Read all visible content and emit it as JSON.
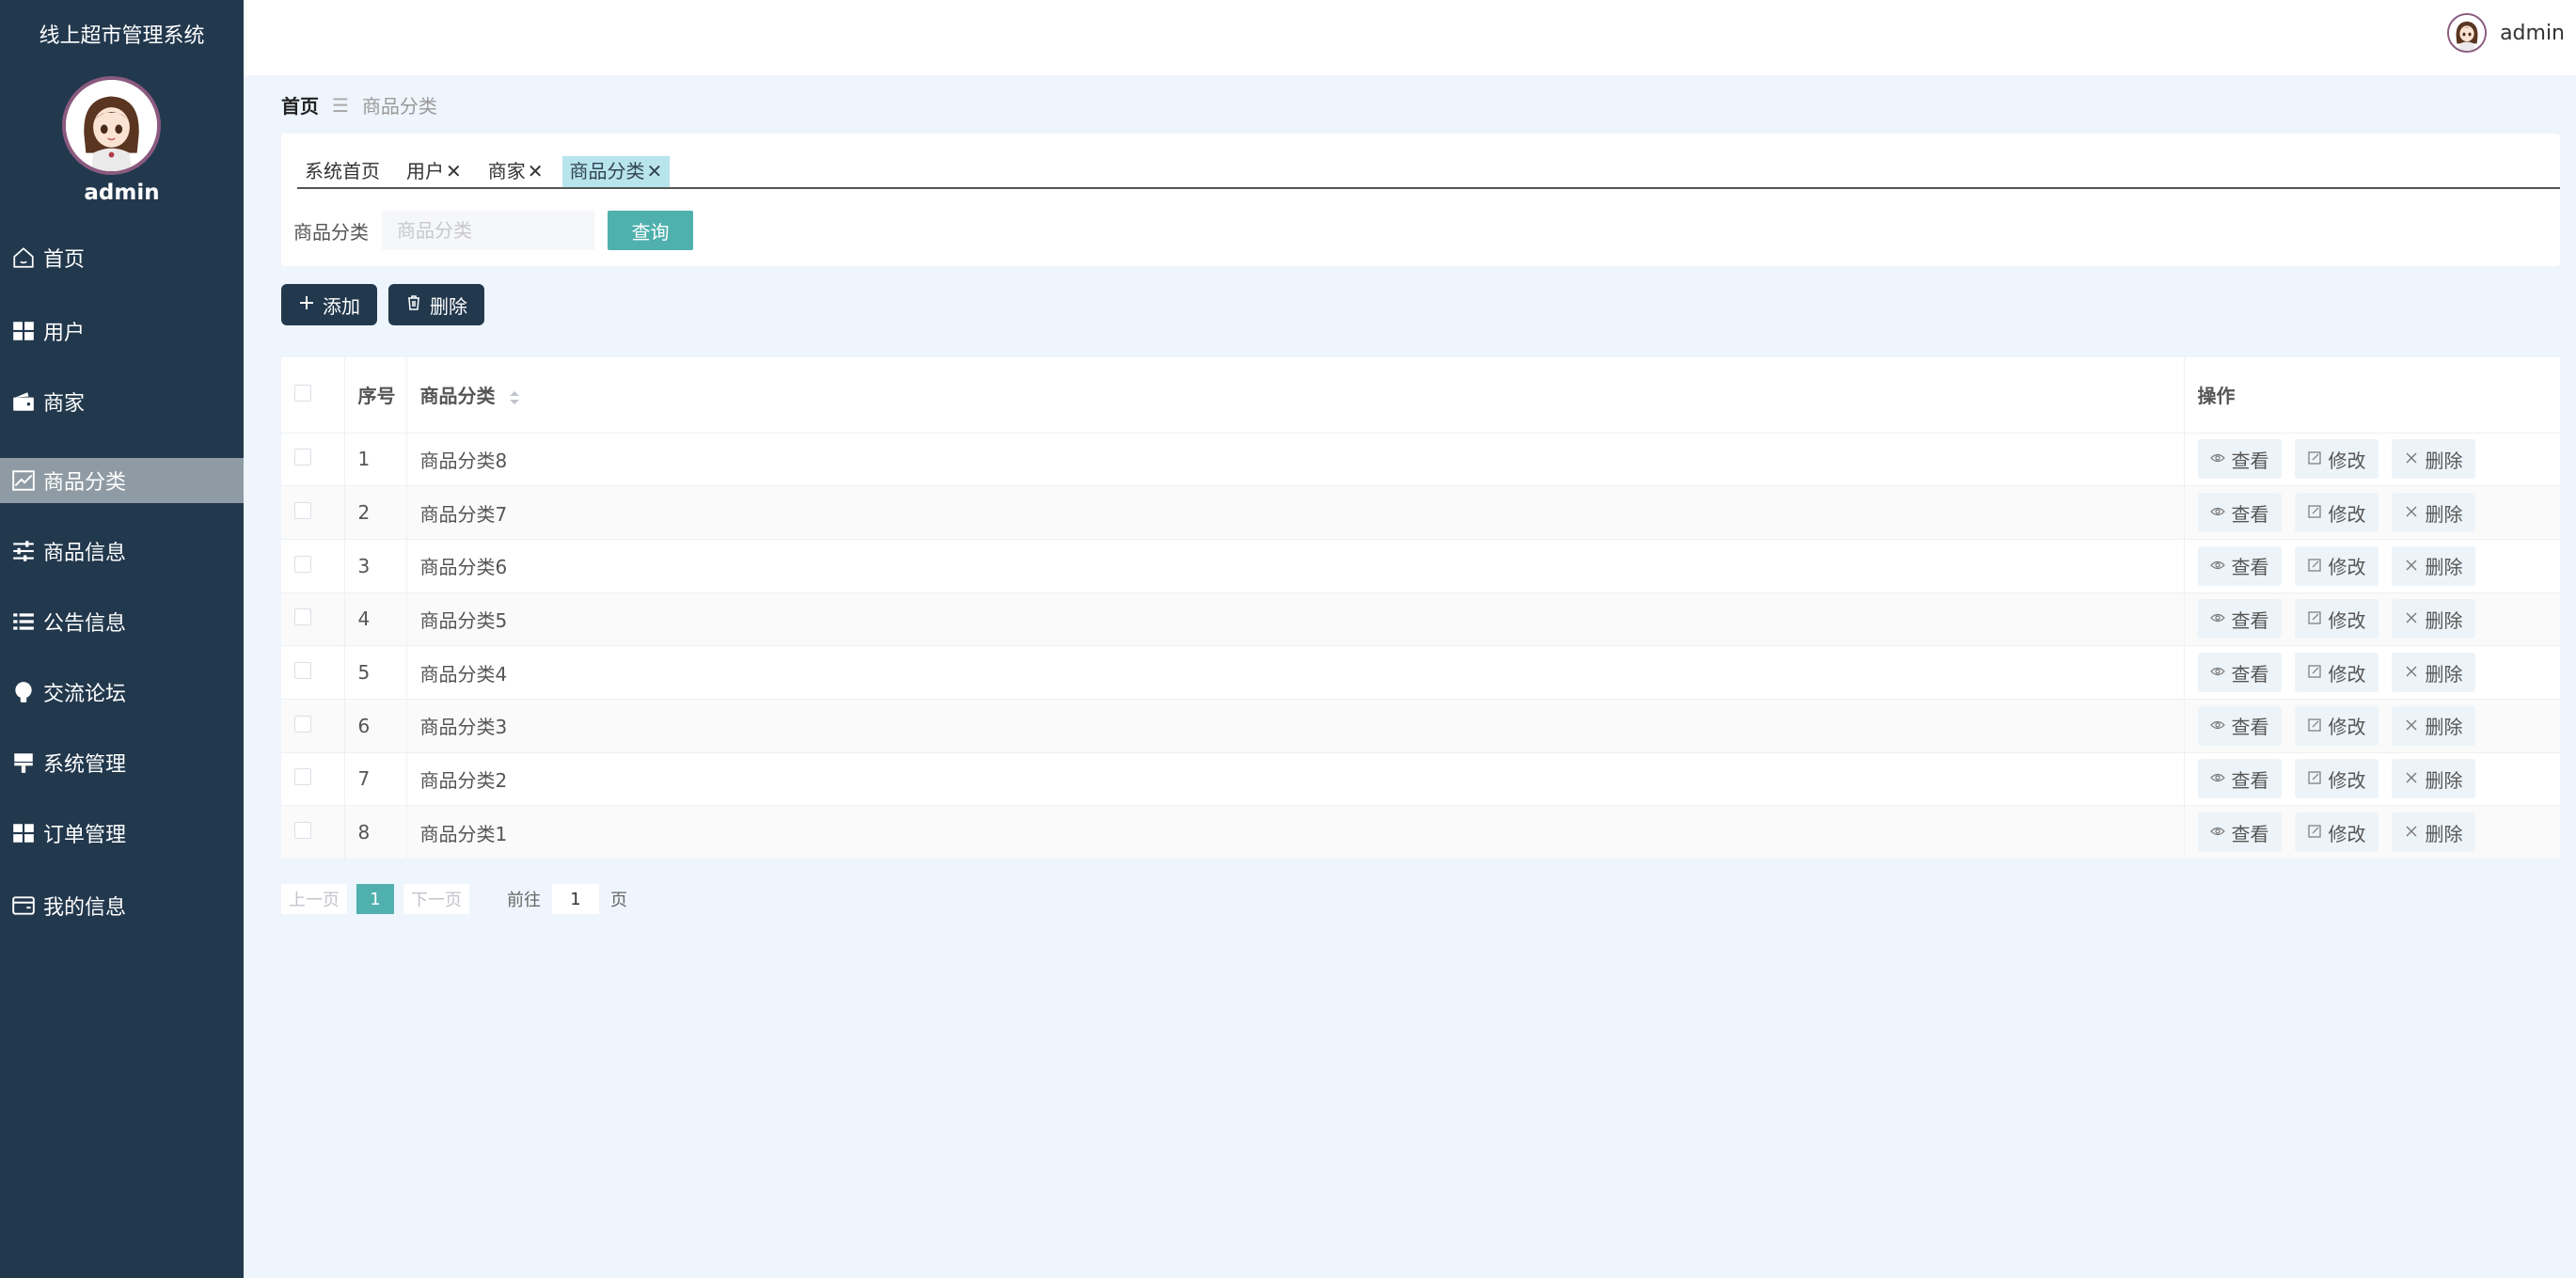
{
  "sidebar": {
    "app_title": "线上超市管理系统",
    "username": "admin",
    "items": [
      {
        "label": "首页",
        "icon": "home-icon"
      },
      {
        "label": "用户",
        "icon": "grid-icon"
      },
      {
        "label": "商家",
        "icon": "wallet-icon"
      },
      {
        "label": "商品分类",
        "icon": "chart-icon",
        "active": true
      },
      {
        "label": "商品信息",
        "icon": "sliders-icon"
      },
      {
        "label": "公告信息",
        "icon": "list-icon"
      },
      {
        "label": "交流论坛",
        "icon": "bulb-icon"
      },
      {
        "label": "系统管理",
        "icon": "brush-icon"
      },
      {
        "label": "订单管理",
        "icon": "grid-icon"
      },
      {
        "label": "我的信息",
        "icon": "card-icon"
      }
    ]
  },
  "topbar": {
    "username": "admin"
  },
  "breadcrumb": {
    "home": "首页",
    "separator": "☰",
    "current": "商品分类"
  },
  "tabs": [
    {
      "label": "系统首页",
      "closable": false
    },
    {
      "label": "用户",
      "closable": true
    },
    {
      "label": "商家",
      "closable": true
    },
    {
      "label": "商品分类",
      "closable": true,
      "active": true
    }
  ],
  "search": {
    "label": "商品分类",
    "placeholder": "商品分类",
    "button": "查询"
  },
  "actions": {
    "add": "添加",
    "delete": "删除"
  },
  "table": {
    "headers": {
      "index": "序号",
      "name": "商品分类",
      "ops": "操作"
    },
    "rows": [
      {
        "index": "1",
        "name": "商品分类8"
      },
      {
        "index": "2",
        "name": "商品分类7"
      },
      {
        "index": "3",
        "name": "商品分类6"
      },
      {
        "index": "4",
        "name": "商品分类5"
      },
      {
        "index": "5",
        "name": "商品分类4"
      },
      {
        "index": "6",
        "name": "商品分类3"
      },
      {
        "index": "7",
        "name": "商品分类2"
      },
      {
        "index": "8",
        "name": "商品分类1"
      }
    ],
    "row_actions": {
      "view": "查看",
      "edit": "修改",
      "delete": "删除"
    }
  },
  "pagination": {
    "prev": "上一页",
    "current": "1",
    "next": "下一页",
    "goto_label": "前往",
    "goto_value": "1",
    "unit": "页"
  },
  "colors": {
    "sidebar_bg": "#22384d",
    "accent": "#4fb0ad",
    "content_bg": "#eef5fc",
    "active_menu": "#8f9ba4"
  }
}
